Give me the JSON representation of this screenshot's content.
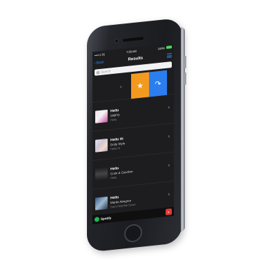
{
  "status_bar": {
    "carrier": "••••• LTE",
    "time": "7:59 AM",
    "battery": "100%"
  },
  "nav": {
    "back_label": "Back",
    "title": "Results"
  },
  "search": {
    "placeholder": "Search"
  },
  "results": [
    {
      "title": "Hello",
      "artist": "OMFG",
      "album": "Hello"
    },
    {
      "title": "Hello Hi",
      "artist": "Dolly Style",
      "album": "Hello Hi"
    },
    {
      "title": "Hello",
      "artist": "Colin & Caroline",
      "album": "Hello"
    },
    {
      "title": "Hello",
      "artist": "Martin Almgren",
      "album": "Can't Hold Me Down"
    }
  ],
  "footer": {
    "service": "Spotify"
  },
  "colors": {
    "star_action": "#f39a1e",
    "share_action": "#2a7ef0",
    "accent": "#2f8cff",
    "spotify_green": "#1db954"
  },
  "icons": {
    "star": "star-icon",
    "share": "share-icon",
    "menu": "hamburger-menu-icon",
    "back": "chevron-left-icon",
    "search": "search-icon",
    "spotify": "spotify-icon"
  }
}
